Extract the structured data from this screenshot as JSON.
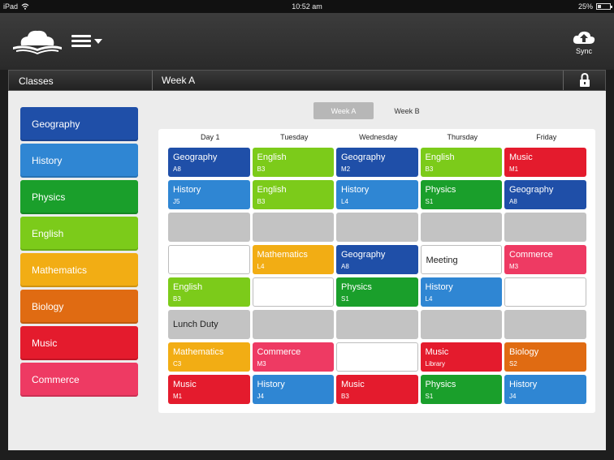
{
  "status_bar": {
    "device": "iPad",
    "time": "10:52 am",
    "battery": "25%"
  },
  "toolbar": {
    "sync_label": "Sync"
  },
  "header": {
    "classes_label": "Classes",
    "week_label": "Week A"
  },
  "week_tabs": {
    "week_a": "Week A",
    "week_b": "Week B"
  },
  "colors": {
    "Geography": "#1f4fa8",
    "History": "#2f86d3",
    "Physics": "#1a9f2b",
    "English": "#7ccb1a",
    "Mathematics": "#f2ad14",
    "Biology": "#e06b12",
    "Music": "#e41b2d",
    "Commerce": "#ee3a63"
  },
  "classes": [
    {
      "label": "Geography"
    },
    {
      "label": "History"
    },
    {
      "label": "Physics"
    },
    {
      "label": "English"
    },
    {
      "label": "Mathematics"
    },
    {
      "label": "Biology"
    },
    {
      "label": "Music"
    },
    {
      "label": "Commerce"
    }
  ],
  "days": [
    "Day 1",
    "Tuesday",
    "Wednesday",
    "Thursday",
    "Friday"
  ],
  "periods": [
    [
      {
        "subject": "Geography",
        "room": "A8"
      },
      {
        "subject": "English",
        "room": "B3"
      },
      {
        "subject": "Geography",
        "room": "M2"
      },
      {
        "subject": "English",
        "room": "B3"
      },
      {
        "subject": "Music",
        "room": "M1"
      }
    ],
    [
      {
        "subject": "History",
        "room": "J5"
      },
      {
        "subject": "English",
        "room": "B3"
      },
      {
        "subject": "History",
        "room": "L4"
      },
      {
        "subject": "Physics",
        "room": "S1"
      },
      {
        "subject": "Geography",
        "room": "A8"
      }
    ],
    [
      {
        "type": "blank"
      },
      {
        "type": "blank"
      },
      {
        "type": "blank"
      },
      {
        "type": "blank"
      },
      {
        "type": "blank"
      }
    ],
    [
      {
        "type": "empty"
      },
      {
        "subject": "Mathematics",
        "room": "L4"
      },
      {
        "subject": "Geography",
        "room": "A8"
      },
      {
        "type": "empty",
        "note": "Meeting"
      },
      {
        "subject": "Commerce",
        "room": "M3"
      }
    ],
    [
      {
        "subject": "English",
        "room": "B3"
      },
      {
        "type": "empty"
      },
      {
        "subject": "Physics",
        "room": "S1"
      },
      {
        "subject": "History",
        "room": "L4"
      },
      {
        "type": "empty"
      }
    ],
    [
      {
        "type": "blank",
        "note": "Lunch Duty"
      },
      {
        "type": "blank"
      },
      {
        "type": "blank"
      },
      {
        "type": "blank"
      },
      {
        "type": "blank"
      }
    ],
    [
      {
        "subject": "Mathematics",
        "room": "C3"
      },
      {
        "subject": "Commerce",
        "room": "M3"
      },
      {
        "type": "empty"
      },
      {
        "subject": "Music",
        "room": "Library"
      },
      {
        "subject": "Biology",
        "room": "S2"
      }
    ],
    [
      {
        "subject": "Music",
        "room": "M1"
      },
      {
        "subject": "History",
        "room": "J4"
      },
      {
        "subject": "Music",
        "room": "B3"
      },
      {
        "subject": "Physics",
        "room": "S1"
      },
      {
        "subject": "History",
        "room": "J4"
      }
    ]
  ]
}
